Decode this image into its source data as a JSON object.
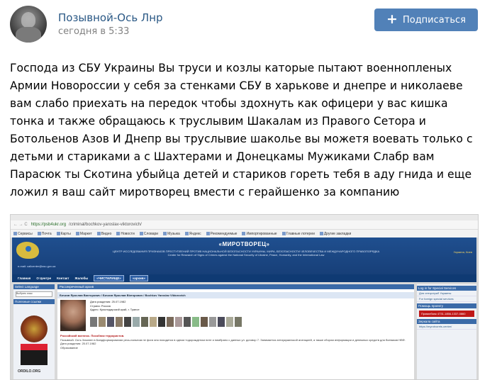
{
  "post": {
    "author": "Позывной-Ось Лнр",
    "time": "сегодня в 5:33",
    "subscribe_label": "Подписаться",
    "text": "Господа из СБУ Украины Вы труси и козлы каторые пытают военнопленых Армии Новороссии у себя за стенками СБУ в харькове и днепре и николаеве вам слабо приехать на передок чтобы здохнуть как офицери у вас кишка тонка и также обращаюсь к труслывим Шакалам из Правого Сетора и Ботольенов Азов И Днепр вы труслывие шаколье вы можетя воевать только с детьми и стариками а с Шахтерами и Донецкамы Мужиками Слабр вам Парасюк ты Скотина убыйца детей и стариков гореть тебя в аду гнида и еще ложил я ваш сайт миротворец вмести с герайшенко за компанию"
  },
  "image": {
    "address": {
      "url": "https://psb4ukr.org",
      "path": "/criminal/bochkov-yaroslav-viktorovich/"
    },
    "bookmarks": [
      "Сервисы",
      "Почта",
      "Карты",
      "Маркет",
      "Видео",
      "Новости",
      "Словари",
      "Музыка",
      "Яндекс",
      "Рекомендуемые",
      "Импортированные",
      "Главные лотереи",
      "Другие закладки"
    ],
    "site": {
      "title": "«МИРОТВОРЕЦ»",
      "subtitle": "ЦЕНТР ИССЛЕДОВАНИЯ ПРИЗНАКОВ ПРЕСТУПЛЕНИЙ ПРОТИВ НАЦИОНАЛЬНОЙ БЕЗОПАСНОСТИ УКРАИНЫ, МИРА, БЕЗОПАСНОСТИ ЧЕЛОВЕЧЕСТВА И МЕЖДУНАРОДНОГО ПРАВОПОРЯДКА",
      "subtitle_en": "Center for Research of Signs of Crimes against the National Security of Ukraine, Peace, Humanity, and the International Law",
      "right_text": "Украина, Киев",
      "email": "e-mail: callcenter@ssu.gov.ua",
      "nav": [
        "Главная",
        "О Центре",
        "Контакт",
        "Жалобы",
        "«ЧИСТИЛИЩЕ»",
        "«архив»"
      ],
      "left": {
        "select_language": "Select Language",
        "select_field": "Выбрать язык",
        "useful_links": "Полезные ссылки",
        "ordilo": "ORDILO.ORG"
      },
      "mid": {
        "header": "Рассекреченный архив",
        "name_band": "Бочков Ярослав Викторович / Бочков Ярослав Вікторович / Bochkov Yaroslav Viktorovich",
        "birth_label": "Дата рождения: 25.07.1982",
        "country": "Страна: Россия",
        "place": "Адрес: Краснодарский край, г. Туапсе",
        "red_line": "Российский военнос. Пособник террористов.",
        "body_text": "Позывной: Ость Зачинен в Бандформировании ресь-пальном не фоги ано находится в одном «одорожденом ните и нимбрано с данных ул. договор 7. Занимается антиукраинской агитацией, а также сбором информации и денежных средств для боевиков НВФ.",
        "education": "Образование"
      },
      "right": {
        "log_in": "Log in for Special Services",
        "link1": "Для спецслужб Украины",
        "link2": "For foreign special services",
        "help": "Помощь проекту",
        "red_box": "Приватбанк 4731-1856-1337-0860",
        "links_head": "Зеркала сайта",
        "mirror": "https://myrotvorets.center/"
      }
    }
  },
  "colors": {
    "link": "#2a5885",
    "button": "#5181b8",
    "time": "#828282"
  }
}
